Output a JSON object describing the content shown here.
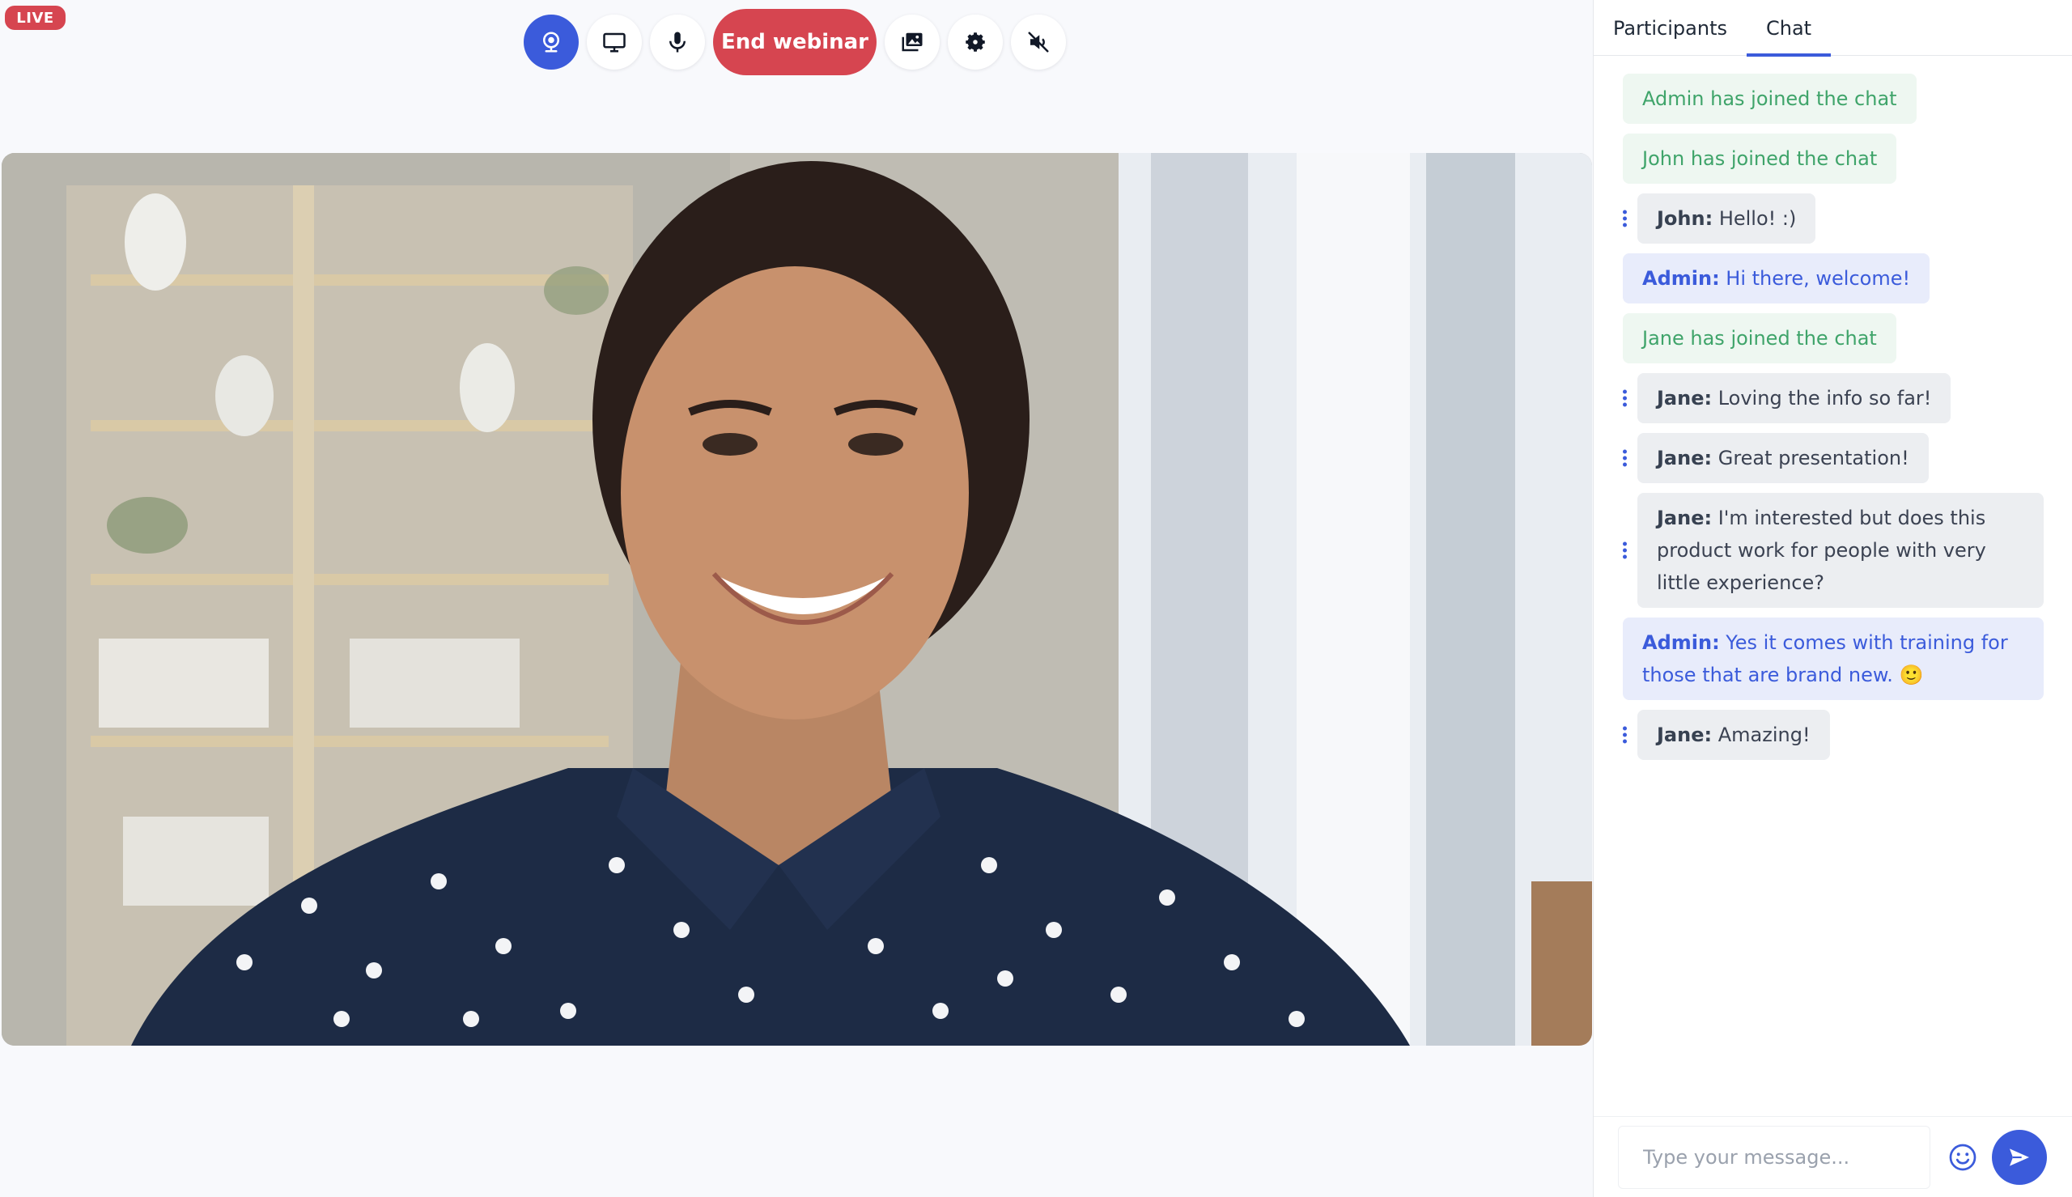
{
  "live_badge": "LIVE",
  "controls": {
    "end_label": "End webinar",
    "buttons": [
      "webcam-icon",
      "screen-share-icon",
      "microphone-icon",
      "media-library-icon",
      "gear-icon",
      "speaker-muted-icon"
    ]
  },
  "tabs": [
    {
      "label": "Participants",
      "active": false
    },
    {
      "label": "Chat",
      "active": true
    }
  ],
  "chat": {
    "messages": [
      {
        "type": "system",
        "text": "Admin has joined the chat"
      },
      {
        "type": "system",
        "text": "John has joined the chat"
      },
      {
        "type": "user",
        "sender": "John:",
        "text": " Hello! :)"
      },
      {
        "type": "admin",
        "sender": "Admin:",
        "text": " Hi there, welcome!"
      },
      {
        "type": "system",
        "text": "Jane has joined the chat"
      },
      {
        "type": "user",
        "sender": "Jane:",
        "text": " Loving the info so far!"
      },
      {
        "type": "user",
        "sender": "Jane:",
        "text": " Great presentation!"
      },
      {
        "type": "user",
        "sender": "Jane:",
        "text": " I'm interested but does this product work for people with very little experience?"
      },
      {
        "type": "admin",
        "sender": "Admin:",
        "text": " Yes it comes with training for those that are brand new. 🙂"
      },
      {
        "type": "user",
        "sender": "Jane:",
        "text": " Amazing!"
      }
    ]
  },
  "composer": {
    "placeholder": "Type your message...",
    "emoji_icon": "smiley-icon",
    "send_icon": "send-icon"
  },
  "colors": {
    "accent": "#3b5bdb",
    "danger": "#d64550",
    "system_text": "#3fa46a"
  }
}
